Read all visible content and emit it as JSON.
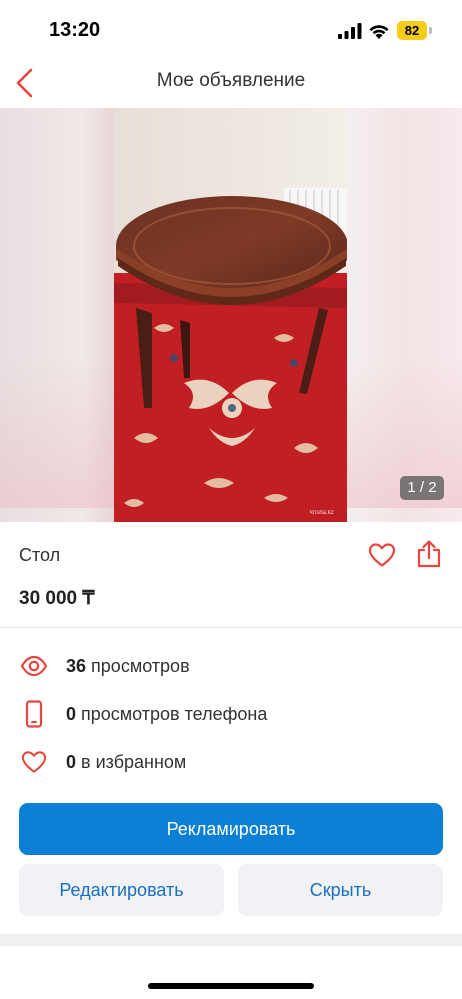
{
  "status_bar": {
    "time": "13:20",
    "battery": "82",
    "icons": [
      "signal-icon",
      "wifi-icon",
      "battery-icon"
    ]
  },
  "nav": {
    "title": "Мое объявление",
    "back_icon": "chevron-left-icon"
  },
  "gallery": {
    "counter": "1 / 2"
  },
  "listing": {
    "title": "Стол",
    "price": "30 000 ₸",
    "favorite_icon": "heart-icon",
    "share_icon": "share-icon"
  },
  "stats": [
    {
      "icon": "eye-icon",
      "count": "36",
      "label": "просмотров"
    },
    {
      "icon": "phone-icon",
      "count": "0",
      "label": "просмотров телефона"
    },
    {
      "icon": "heart-icon",
      "count": "0",
      "label": "в избранном"
    }
  ],
  "actions": {
    "promote": "Рекламировать",
    "edit": "Редактировать",
    "hide": "Скрыть"
  },
  "colors": {
    "accent_red": "#e8453c",
    "primary_blue": "#0a7fd3",
    "secondary_text_blue": "#1a6fc0",
    "battery_yellow": "#f5cc18"
  }
}
